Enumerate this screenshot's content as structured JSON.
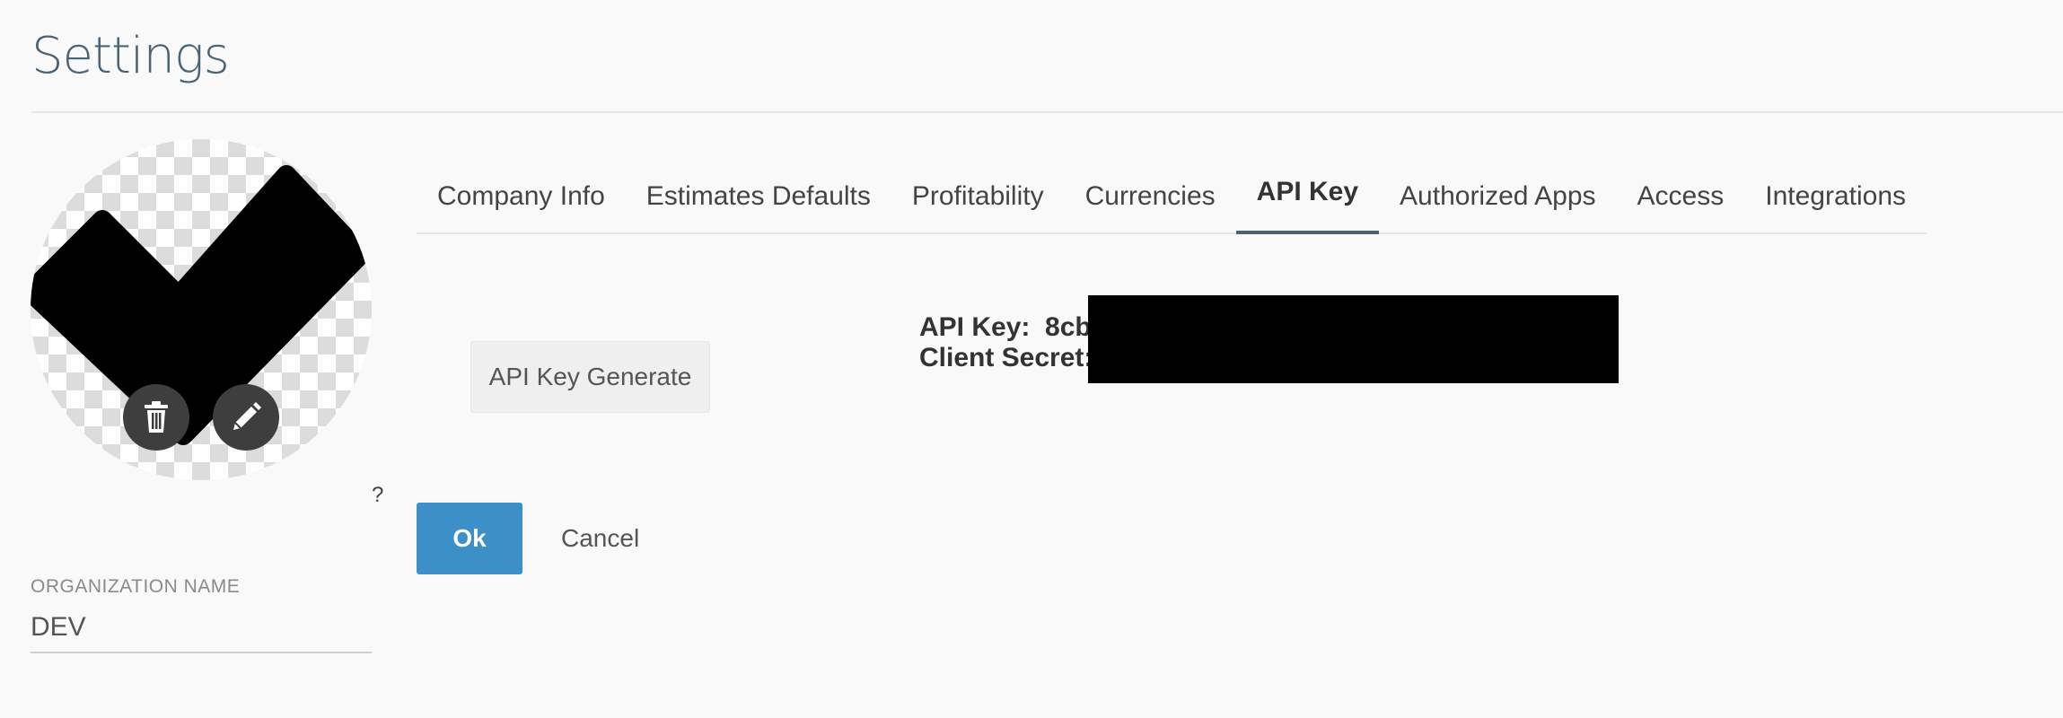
{
  "page": {
    "title": "Settings"
  },
  "logo": {
    "image": "checkmark-logo",
    "delete_icon": "trash-icon",
    "edit_icon": "pencil-icon",
    "help": "?"
  },
  "organization": {
    "label": "ORGANIZATION NAME",
    "value": "DEV"
  },
  "tabs": [
    {
      "label": "Company Info",
      "active": false
    },
    {
      "label": "Estimates Defaults",
      "active": false
    },
    {
      "label": "Profitability",
      "active": false
    },
    {
      "label": "Currencies",
      "active": false
    },
    {
      "label": "API Key",
      "active": true
    },
    {
      "label": "Authorized Apps",
      "active": false
    },
    {
      "label": "Access",
      "active": false
    },
    {
      "label": "Integrations",
      "active": false
    }
  ],
  "api": {
    "generate_label": "API Key Generate",
    "key_label": "API Key:",
    "key_value": "8cb4",
    "secret_label": "Client Secret:"
  },
  "actions": {
    "ok_label": "Ok",
    "cancel_label": "Cancel"
  },
  "colors": {
    "accent": "#3c8fc7",
    "title": "#4a6476",
    "tab_indicator": "#4a6476"
  }
}
